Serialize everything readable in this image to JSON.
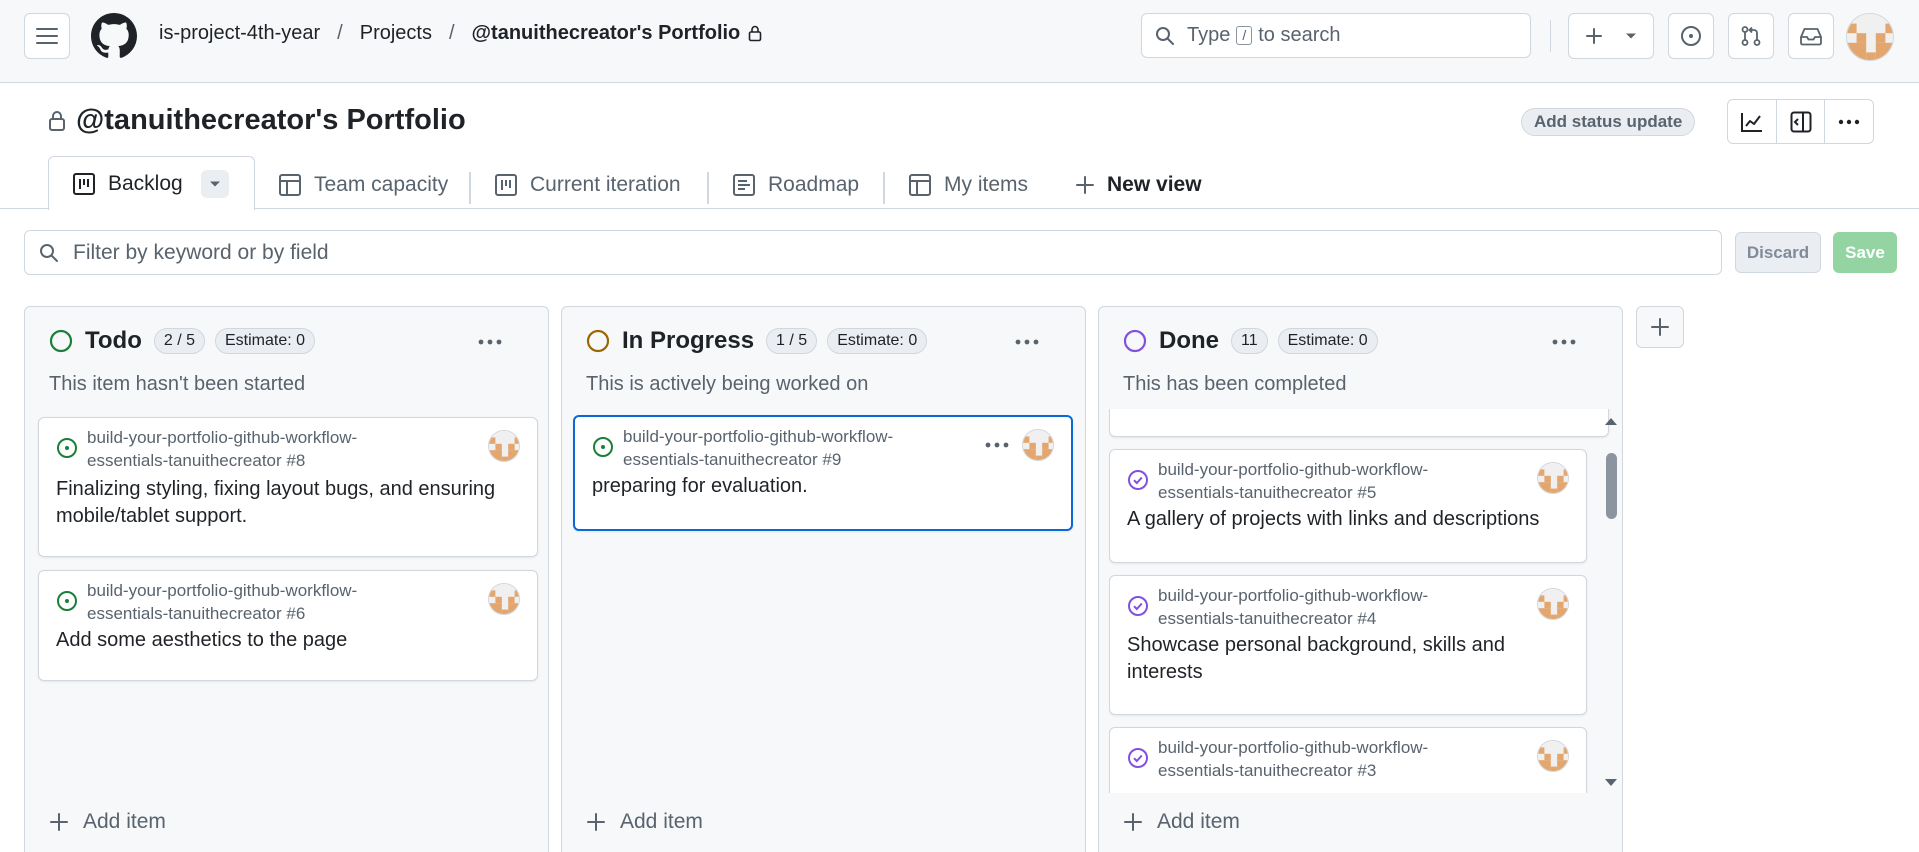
{
  "header": {
    "breadcrumb": [
      "is-project-4th-year",
      "Projects",
      "@tanuithecreator's Portfolio"
    ],
    "search_pre": "Type",
    "search_key": "/",
    "search_post": "to search"
  },
  "project": {
    "title": "@tanuithecreator's Portfolio",
    "status_update_label": "Add status update"
  },
  "tabs": [
    "Backlog",
    "Team capacity",
    "Current iteration",
    "Roadmap",
    "My items",
    "New view"
  ],
  "filter": {
    "placeholder": "Filter by keyword or by field",
    "discard_label": "Discard",
    "save_label": "Save"
  },
  "columns": [
    {
      "name": "Todo",
      "count": "2 / 5",
      "estimate": "Estimate: 0",
      "description": "This item hasn't been started",
      "status_color": "#1a7f37",
      "add_label": "Add item",
      "cards": [
        {
          "repo": "build-your-portfolio-github-workflow-essentials-tanuithecreator #8",
          "title": "Finalizing styling, fixing layout bugs, and ensuring mobile/tablet support."
        },
        {
          "repo": "build-your-portfolio-github-workflow-essentials-tanuithecreator #6",
          "title": "Add some aesthetics to the page"
        }
      ]
    },
    {
      "name": "In Progress",
      "count": "1 / 5",
      "estimate": "Estimate: 0",
      "description": "This is actively being worked on",
      "status_color": "#9a6700",
      "add_label": "Add item",
      "cards": [
        {
          "repo": "build-your-portfolio-github-workflow-essentials-tanuithecreator #9",
          "title": "preparing for evaluation."
        }
      ]
    },
    {
      "name": "Done",
      "count": "11",
      "estimate": "Estimate: 0",
      "description": "This has been completed",
      "status_color": "#8250df",
      "add_label": "Add item",
      "cards": [
        {
          "repo": "build-your-portfolio-github-workflow-essentials-tanuithecreator #5",
          "title": "A gallery of projects with links and descriptions"
        },
        {
          "repo": "build-your-portfolio-github-workflow-essentials-tanuithecreator #4",
          "title": "Showcase personal background, skills and interests"
        },
        {
          "repo": "build-your-portfolio-github-workflow-essentials-tanuithecreator #3",
          "title": ""
        }
      ]
    }
  ],
  "colors": {
    "accent": "#0969da",
    "open_issue": "#1a7f37",
    "closed_issue": "#8250df",
    "save_button": "#94d3a2"
  }
}
